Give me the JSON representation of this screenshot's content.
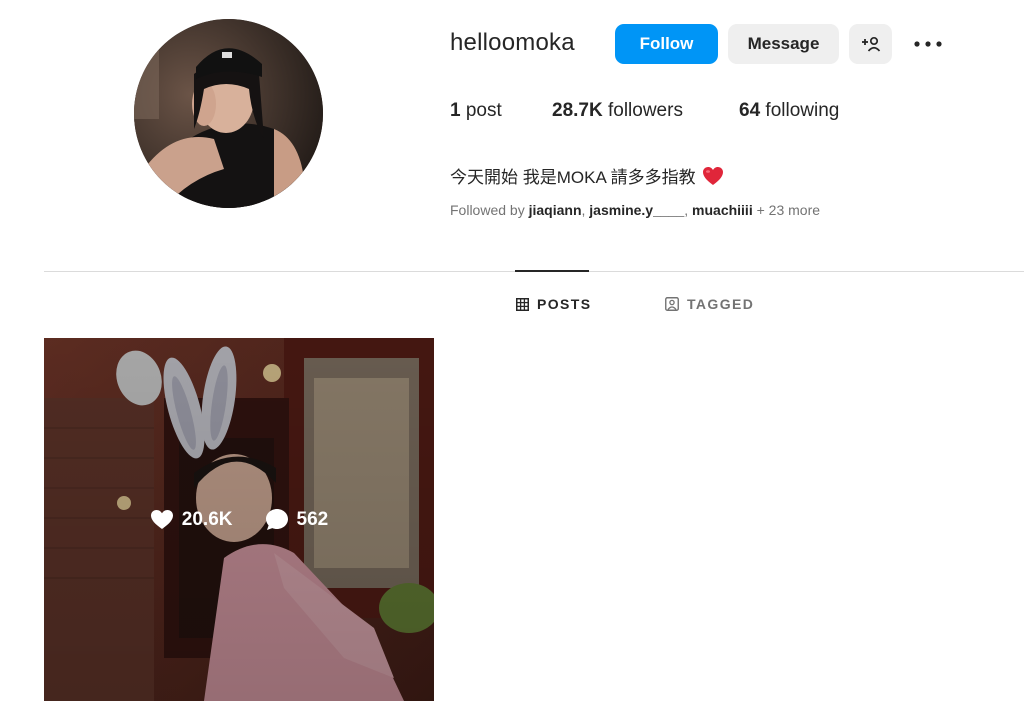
{
  "profile": {
    "username": "helloomoka",
    "bio": "今天開始 我是MOKA 請多多指教",
    "bio_emoji": "heart-emoji"
  },
  "actions": {
    "follow_label": "Follow",
    "message_label": "Message",
    "suggest_icon": "add-person-icon",
    "more_icon": "more-options-icon"
  },
  "stats": {
    "posts_count": "1",
    "posts_label": "post",
    "followers_count": "28.7K",
    "followers_label": "followers",
    "following_count": "64",
    "following_label": "following"
  },
  "followed_by": {
    "prefix": "Followed by",
    "users": [
      "jiaqiann",
      "jasmine.y____",
      "muachiiii"
    ],
    "more": "+ 23 more"
  },
  "tabs": [
    {
      "label": "POSTS",
      "icon": "grid-icon",
      "active": true
    },
    {
      "label": "TAGGED",
      "icon": "tagged-icon",
      "active": false
    }
  ],
  "posts": [
    {
      "likes": "20.6K",
      "comments": "562"
    }
  ],
  "colors": {
    "accent": "#0095f6",
    "button_gray": "#efefef",
    "text": "#262626",
    "muted": "#737373",
    "heart": "#e0263a"
  }
}
